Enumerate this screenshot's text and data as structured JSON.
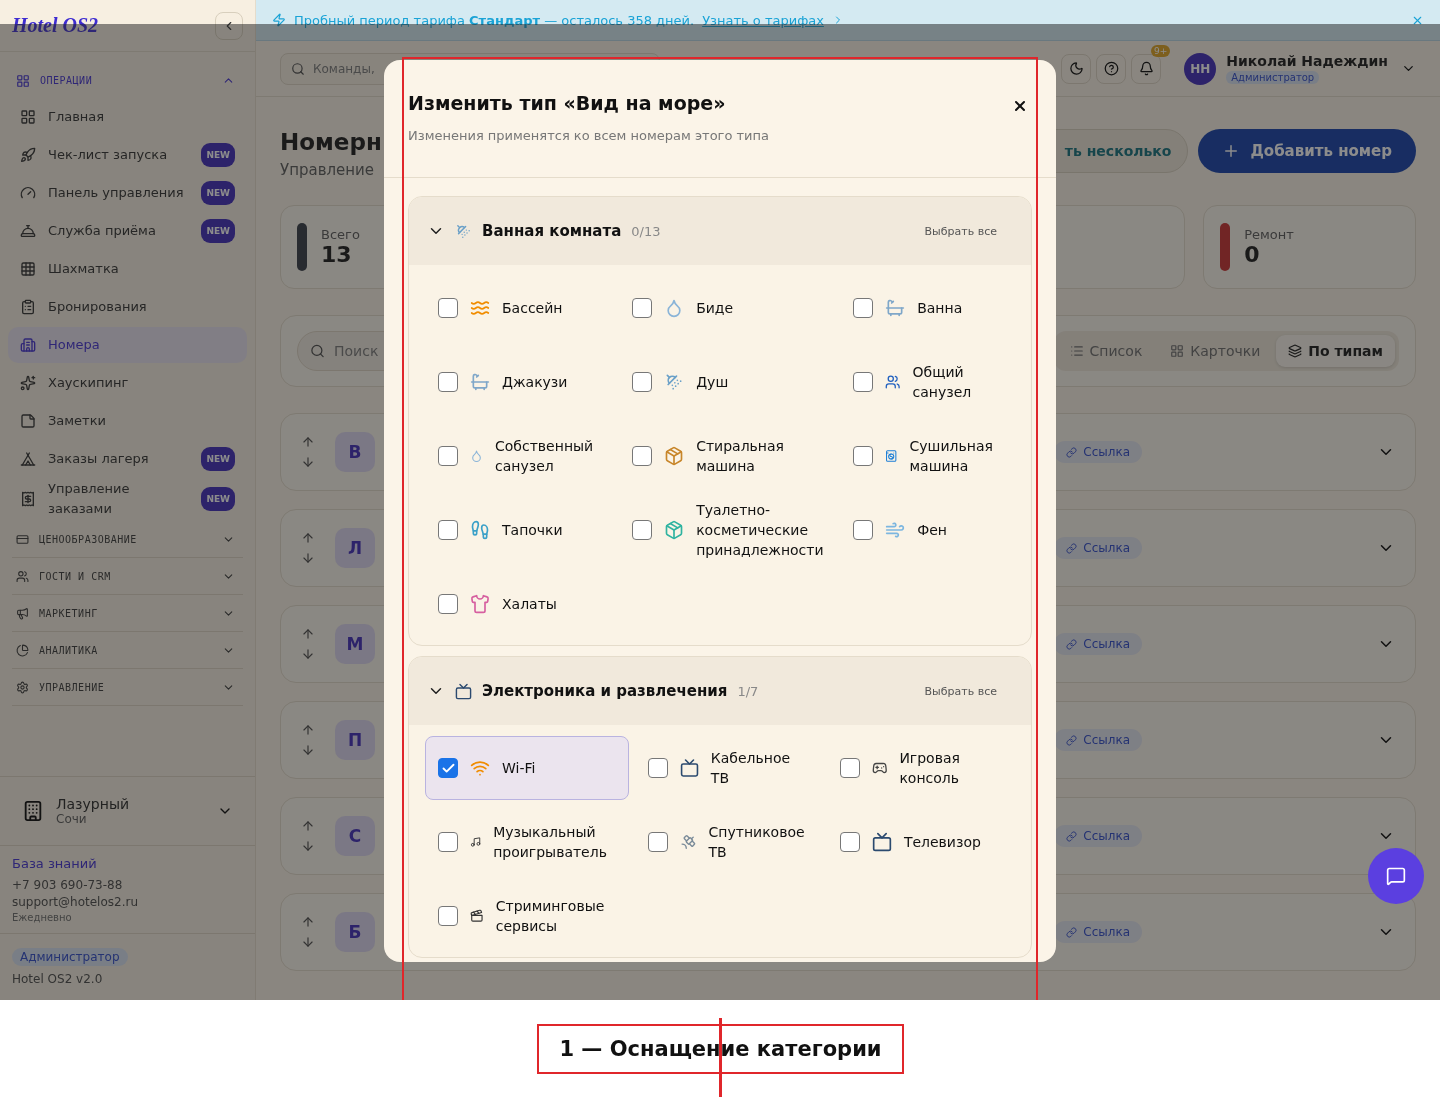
{
  "banner": {
    "text": "Пробный период тарифа **Стандарт** — осталось 358 дней.",
    "link": "Узнать о тарифах"
  },
  "sidebar": {
    "logo": "Hotel OS2",
    "groups": [
      {
        "title": "ОПЕРАЦИИ",
        "expanded": true,
        "items": [
          {
            "label": "Главная",
            "selected": false
          },
          {
            "label": "Чек-лист запуска",
            "badge": "NEW",
            "selected": false
          },
          {
            "label": "Панель управления",
            "badge": "NEW",
            "selected": false
          },
          {
            "label": "Служба приёма",
            "badge": "NEW",
            "selected": false
          },
          {
            "label": "Шахматка",
            "selected": false
          },
          {
            "label": "Бронирования",
            "selected": false
          },
          {
            "label": "Номера",
            "selected": true
          },
          {
            "label": "Хаускипинг",
            "selected": false
          },
          {
            "label": "Заметки",
            "selected": false
          },
          {
            "label": "Заказы лагеря",
            "badge": "NEW",
            "selected": false
          },
          {
            "label": "Управление заказами",
            "badge": "NEW",
            "selected": false
          }
        ]
      },
      {
        "title": "ЦЕНООБРАЗОВАНИЕ",
        "expanded": false
      },
      {
        "title": "ГОСТИ И CRM",
        "expanded": false
      },
      {
        "title": "МАРКЕТИНГ",
        "expanded": false
      },
      {
        "title": "АНАЛИТИКА",
        "expanded": false
      },
      {
        "title": "УПРАВЛЕНИЕ",
        "expanded": false
      }
    ],
    "property": {
      "name": "Лазурный",
      "city": "Сочи"
    },
    "support": {
      "link": "База знаний",
      "phone": "+7 903 690-73-88",
      "email": "support@hotelos2.ru",
      "hours": "Ежедневно"
    },
    "role": "Администратор",
    "version": "Hotel OS2 v2.0"
  },
  "topbar": {
    "search_placeholder": "Команды, ",
    "notifications": "9+",
    "user": {
      "initials": "НН",
      "name": "Николай Надеждин",
      "role": "Администратор"
    }
  },
  "page": {
    "title": "Номерн",
    "subtitle": "Управление",
    "buttons": [
      {
        "label": "ть несколько",
        "kind": "secondary"
      },
      {
        "label": "Добавить номер",
        "kind": "primary"
      }
    ],
    "stats": [
      {
        "label": "Всего",
        "value": "13",
        "kind": "total"
      },
      {
        "label": "Ремонт",
        "value": "0",
        "kind": "repair"
      }
    ],
    "search_placeholder": "Поиск",
    "view_modes": [
      {
        "label": "Список",
        "selected": false
      },
      {
        "label": "Карточки",
        "selected": false
      },
      {
        "label": "По типам",
        "selected": true
      }
    ],
    "room_types": [
      {
        "letter": "В",
        "link": "Ссылка"
      },
      {
        "letter": "Л",
        "link": "Ссылка"
      },
      {
        "letter": "М",
        "link": "Ссылка"
      },
      {
        "letter": "П",
        "link": "Ссылка"
      },
      {
        "letter": "С",
        "link": "Ссылка"
      },
      {
        "letter": "Б",
        "link": "Ссылка"
      }
    ]
  },
  "modal": {
    "title": "Изменить тип «Вид на море»",
    "subtitle": "Изменения применятся ко всем номерам этого типа",
    "categories": [
      {
        "name": "Ванная комната",
        "count": "0/13",
        "select_all": "Выбрать все",
        "expanded": true,
        "items": [
          {
            "label": "Бассейн",
            "checked": false
          },
          {
            "label": "Биде",
            "checked": false
          },
          {
            "label": "Ванна",
            "checked": false
          },
          {
            "label": "Джакузи",
            "checked": false
          },
          {
            "label": "Душ",
            "checked": false
          },
          {
            "label": "Общий санузел",
            "checked": false
          },
          {
            "label": "Собственный санузел",
            "checked": false
          },
          {
            "label": "Стиральная машина",
            "checked": false
          },
          {
            "label": "Сушильная машина",
            "checked": false
          },
          {
            "label": "Тапочки",
            "checked": false
          },
          {
            "label": "Туалетно-косметические принадлежности",
            "checked": false
          },
          {
            "label": "Фен",
            "checked": false
          },
          {
            "label": "Халаты",
            "checked": false
          }
        ]
      },
      {
        "name": "Электроника и развлечения",
        "count": "1/7",
        "select_all": "Выбрать все",
        "expanded": true,
        "items": [
          {
            "label": "Wi-Fi",
            "checked": true
          },
          {
            "label": "Кабельное ТВ",
            "checked": false
          },
          {
            "label": "Игровая консоль",
            "checked": false
          },
          {
            "label": "Музыкальный проигрыватель",
            "checked": false
          },
          {
            "label": "Спутниковое ТВ",
            "checked": false
          },
          {
            "label": "Телевизор",
            "checked": false
          },
          {
            "label": "Стриминговые сервисы",
            "checked": false
          }
        ]
      }
    ]
  },
  "annotation": {
    "caption": "1 — Оснащение категории"
  }
}
